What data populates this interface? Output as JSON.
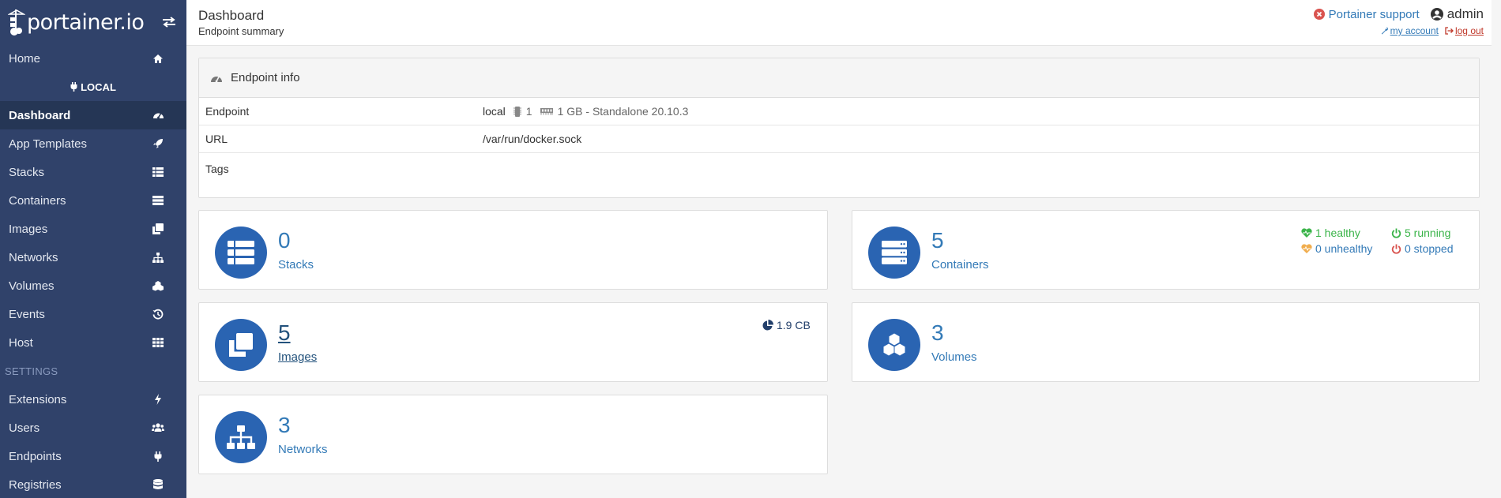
{
  "brand": {
    "name": "portainer.io"
  },
  "sidebar": {
    "home": "Home",
    "endpoint": "LOCAL",
    "items": [
      {
        "label": "Dashboard",
        "icon": "tachometer-icon"
      },
      {
        "label": "App Templates",
        "icon": "rocket-icon"
      },
      {
        "label": "Stacks",
        "icon": "th-list-icon"
      },
      {
        "label": "Containers",
        "icon": "server-icon"
      },
      {
        "label": "Images",
        "icon": "clone-icon"
      },
      {
        "label": "Networks",
        "icon": "sitemap-icon"
      },
      {
        "label": "Volumes",
        "icon": "cubes-icon"
      },
      {
        "label": "Events",
        "icon": "history-icon"
      },
      {
        "label": "Host",
        "icon": "th-icon"
      }
    ],
    "settings_title": "SETTINGS",
    "settings_items": [
      {
        "label": "Extensions",
        "icon": "bolt-icon"
      },
      {
        "label": "Users",
        "icon": "users-icon"
      },
      {
        "label": "Endpoints",
        "icon": "plug-icon"
      },
      {
        "label": "Registries",
        "icon": "database-icon"
      }
    ]
  },
  "header": {
    "title": "Dashboard",
    "subtitle": "Endpoint summary",
    "support": "Portainer support",
    "user": "admin",
    "my_account": "my account",
    "log_out": "log out"
  },
  "endpoint_info": {
    "title": "Endpoint info",
    "rows": {
      "endpoint_label": "Endpoint",
      "endpoint_name": "local",
      "cpu": "1",
      "memory": "1 GB - Standalone 20.10.3",
      "url_label": "URL",
      "url": "/var/run/docker.sock",
      "tags_label": "Tags"
    }
  },
  "widgets": {
    "stacks": {
      "count": "0",
      "label": "Stacks"
    },
    "containers": {
      "count": "5",
      "label": "Containers",
      "healthy": "1 healthy",
      "unhealthy": "0 unhealthy",
      "running": "5 running",
      "stopped": "0 stopped"
    },
    "images": {
      "count": "5",
      "label": "Images",
      "size": "1.9 CB"
    },
    "volumes": {
      "count": "3",
      "label": "Volumes"
    },
    "networks": {
      "count": "3",
      "label": "Networks"
    }
  },
  "colors": {
    "sidebar_bg": "#30426a",
    "sidebar_active": "#253655",
    "accent": "#2a64b2",
    "link": "#337ab7",
    "healthy": "#3bb44a",
    "unhealthy": "#f0ad4e",
    "stopped": "#d9534f"
  }
}
